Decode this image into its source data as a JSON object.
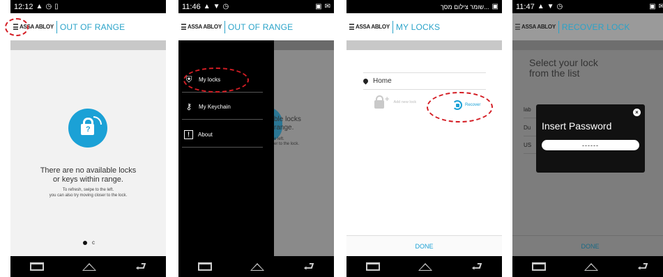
{
  "panels": [
    {
      "status": {
        "time": "12:12"
      },
      "app": {
        "brand": "ASSA ABLOY",
        "title": "OUT OF RANGE"
      },
      "message": {
        "line1": "There are no available locks",
        "line2": "or keys within range.",
        "hint1": "To refresh, swipe to the left.",
        "hint2": "you can also try moving closer to the lock."
      },
      "pager": {
        "inactive_glyph": "c"
      }
    },
    {
      "status": {
        "time": "11:46"
      },
      "app": {
        "brand": "ASSA ABLOY",
        "title": "OUT OF RANGE"
      },
      "drawer": {
        "items": [
          {
            "label": "My locks",
            "icon": "lock-icon"
          },
          {
            "label": "My Keychain",
            "icon": "key-icon"
          },
          {
            "label": "About",
            "icon": "info-icon"
          }
        ]
      },
      "ghost": {
        "line1": "ble locks",
        "line2": "range.",
        "hint1": "e left.",
        "hint2": "er to the lock."
      }
    },
    {
      "status": {
        "time": "שומר צילום מסך..."
      },
      "app": {
        "brand": "ASSA ABLOY",
        "title": "MY LOCKS"
      },
      "list": {
        "home_label": "Home",
        "add_label": "Add new lock",
        "recover_label": "Recover"
      },
      "done_label": "DONE"
    },
    {
      "status": {
        "time": "11:47"
      },
      "app": {
        "brand": "ASSA ABLOY",
        "title": "RECOVER LOCK"
      },
      "select": {
        "line1": "Select your lock",
        "line2": "from the list"
      },
      "bg_rows": [
        "lab",
        "Du",
        "US"
      ],
      "dialog": {
        "title": "Insert Password",
        "input_value": "------",
        "close_glyph": "×"
      },
      "done_label": "DONE"
    }
  ],
  "colors": {
    "accent": "#1ba1d6",
    "annotation": "#d41d24"
  }
}
